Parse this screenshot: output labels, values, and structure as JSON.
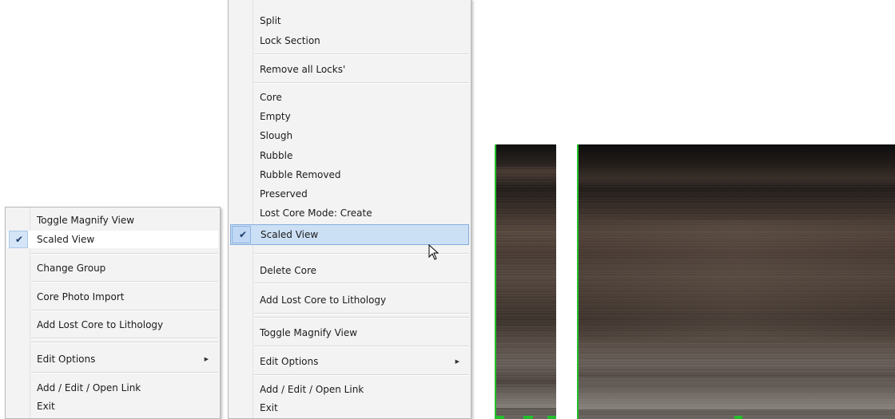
{
  "menu_left": {
    "items": [
      {
        "label": "Toggle Magnify View"
      },
      {
        "label": "Scaled View",
        "checked": true
      },
      {
        "label": "Change Group"
      },
      {
        "label": "Core Photo Import"
      },
      {
        "label": "Add Lost Core to Lithology"
      },
      {
        "label": "Edit Options",
        "submenu": true
      },
      {
        "label": "Add / Edit / Open Link"
      },
      {
        "label": "Exit"
      }
    ]
  },
  "menu_right": {
    "items": [
      {
        "label": "Split"
      },
      {
        "label": "Lock Section"
      },
      {
        "label": "Remove all Locks'"
      },
      {
        "label": "Core"
      },
      {
        "label": "Empty"
      },
      {
        "label": "Slough"
      },
      {
        "label": "Rubble"
      },
      {
        "label": "Rubble Removed"
      },
      {
        "label": "Preserved"
      },
      {
        "label": "Lost Core Mode: Create"
      },
      {
        "label": "Scaled View",
        "checked": true,
        "hover": true
      },
      {
        "label": "Delete Core"
      },
      {
        "label": "Add Lost Core to Lithology"
      },
      {
        "label": "Toggle Magnify View"
      },
      {
        "label": "Edit Options",
        "submenu": true
      },
      {
        "label": "Add / Edit / Open Link"
      },
      {
        "label": "Exit"
      }
    ]
  },
  "glyphs": {
    "check": "✔",
    "submenu_arrow": "▶"
  },
  "colors": {
    "highlight": "#cce0f5",
    "check_bg": "#d4e5f7",
    "photo_border": "#22c02a"
  },
  "photos": [
    {
      "name": "core-photo-narrow"
    },
    {
      "name": "core-photo-wide"
    }
  ]
}
